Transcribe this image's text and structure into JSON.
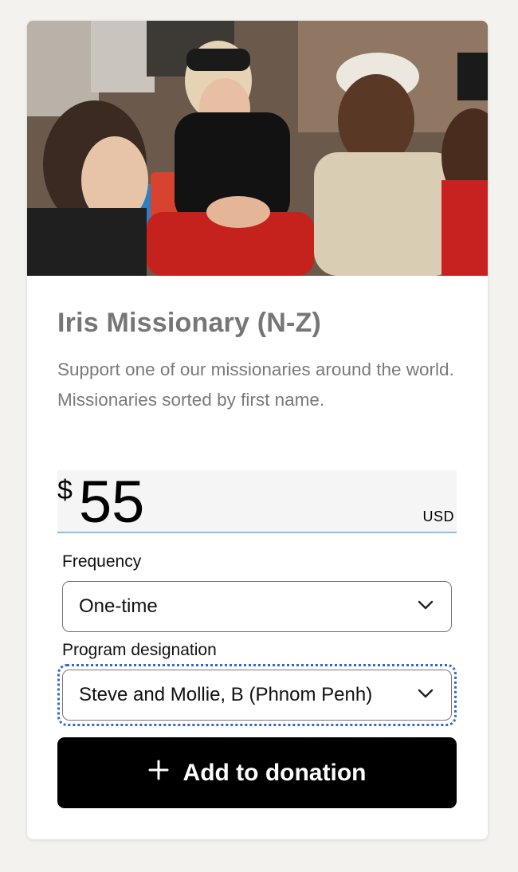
{
  "card": {
    "title": "Iris Missionary (N-Z)",
    "description": "Support one of our missionaries around the world. Missionaries sorted by first name."
  },
  "amount": {
    "currency_symbol": "$",
    "value": "55",
    "currency_code": "USD"
  },
  "frequency": {
    "label": "Frequency",
    "selected": "One-time"
  },
  "program": {
    "label": "Program designation",
    "selected": "Steve and Mollie, B (Phnom Penh)"
  },
  "actions": {
    "add_label": "Add to donation"
  },
  "icons": {
    "chevron": "chevron-down-icon",
    "plus": "plus-icon"
  },
  "colors": {
    "button_bg": "#000000",
    "amount_underline": "#8cc0da",
    "focus_ring": "#3a63d6",
    "title_text": "#767676"
  }
}
